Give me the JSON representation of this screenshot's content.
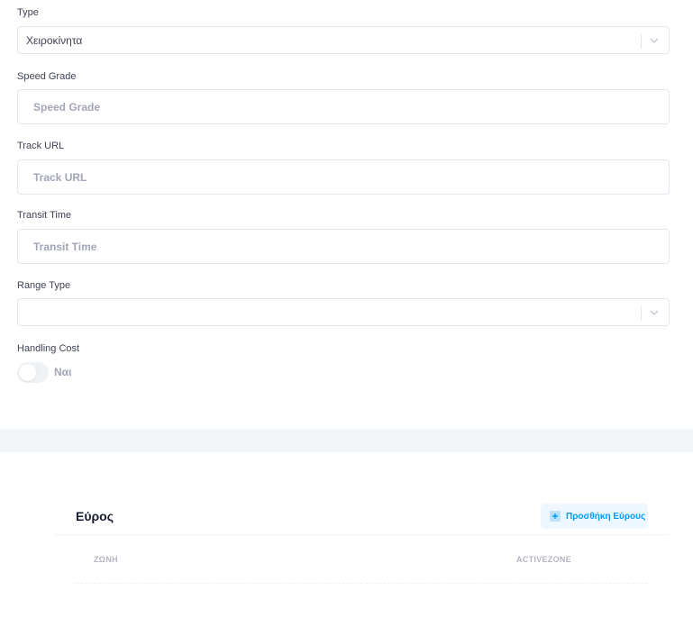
{
  "form": {
    "type": {
      "label": "Type",
      "value": "Χειροκίνητα"
    },
    "speed_grade": {
      "label": "Speed Grade",
      "placeholder": "Speed Grade"
    },
    "track_url": {
      "label": "Track URL",
      "placeholder": "Track URL"
    },
    "transit_time": {
      "label": "Transit Time",
      "placeholder": "Transit Time"
    },
    "range_type": {
      "label": "Range Type",
      "value": ""
    },
    "handling_cost": {
      "label": "Handling Cost",
      "toggle_label": "Ναι",
      "enabled": false
    }
  },
  "ranges_card": {
    "title": "Εύρος",
    "add_button_label": "Προσθήκη Εύρους",
    "columns": [
      "ΖΩΝΗ",
      "ACTIVEZONE"
    ]
  },
  "colors": {
    "accent": "#009ef7",
    "border": "#e4e6ef",
    "muted_text": "#a1a5b7",
    "band": "#f3f6f9"
  }
}
